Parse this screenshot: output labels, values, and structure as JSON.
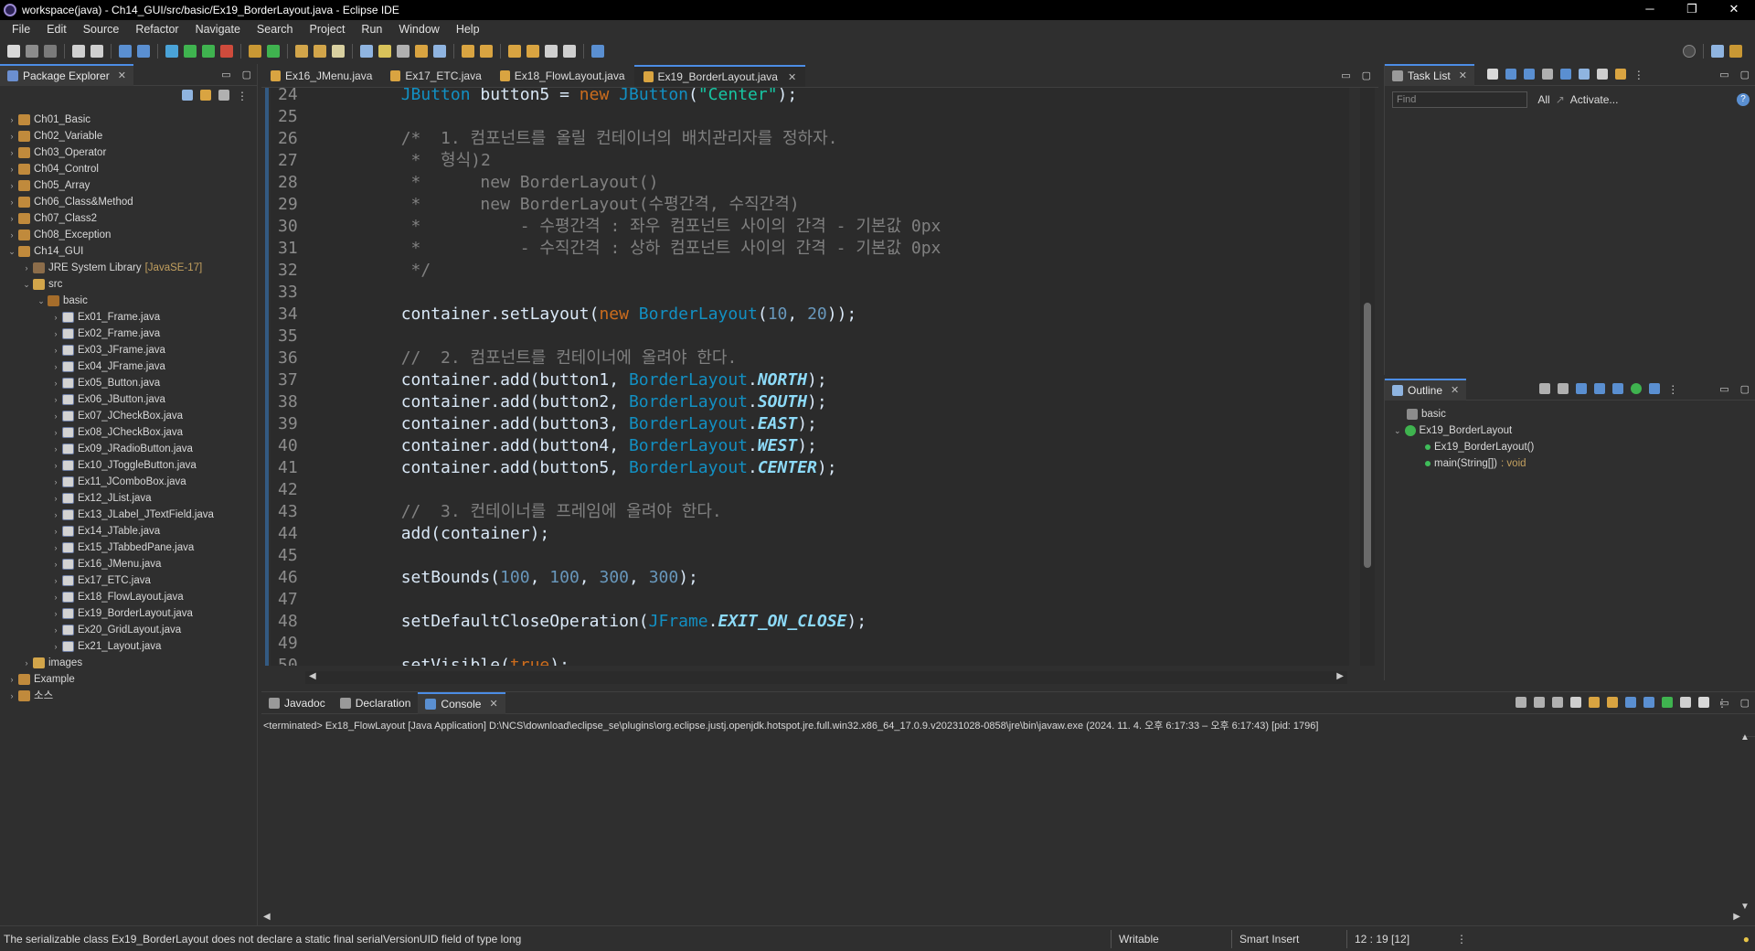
{
  "window": {
    "title": "workspace(java) - Ch14_GUI/src/basic/Ex19_BorderLayout.java - Eclipse IDE",
    "min": "─",
    "max": "❐",
    "close": "✕"
  },
  "menu": [
    "File",
    "Edit",
    "Source",
    "Refactor",
    "Navigate",
    "Search",
    "Project",
    "Run",
    "Window",
    "Help"
  ],
  "package_explorer": {
    "tab": "Package Explorer",
    "items": [
      {
        "label": "Ch01_Basic",
        "indent": 0,
        "arrow": "›",
        "icon": "proj"
      },
      {
        "label": "Ch02_Variable",
        "indent": 0,
        "arrow": "›",
        "icon": "proj"
      },
      {
        "label": "Ch03_Operator",
        "indent": 0,
        "arrow": "›",
        "icon": "proj"
      },
      {
        "label": "Ch04_Control",
        "indent": 0,
        "arrow": "›",
        "icon": "proj"
      },
      {
        "label": "Ch05_Array",
        "indent": 0,
        "arrow": "›",
        "icon": "proj"
      },
      {
        "label": "Ch06_Class&Method",
        "indent": 0,
        "arrow": "›",
        "icon": "proj"
      },
      {
        "label": "Ch07_Class2",
        "indent": 0,
        "arrow": "›",
        "icon": "proj"
      },
      {
        "label": "Ch08_Exception",
        "indent": 0,
        "arrow": "›",
        "icon": "proj"
      },
      {
        "label": "Ch14_GUI",
        "indent": 0,
        "arrow": "⌄",
        "icon": "proj"
      },
      {
        "label": "JRE System Library",
        "decor": "[JavaSE-17]",
        "indent": 1,
        "arrow": "›",
        "icon": "lib"
      },
      {
        "label": "src",
        "indent": 1,
        "arrow": "⌄",
        "icon": "folder"
      },
      {
        "label": "basic",
        "indent": 2,
        "arrow": "⌄",
        "icon": "pkgi"
      },
      {
        "label": "Ex01_Frame.java",
        "indent": 3,
        "arrow": "›",
        "icon": "javaf"
      },
      {
        "label": "Ex02_Frame.java",
        "indent": 3,
        "arrow": "›",
        "icon": "javaf"
      },
      {
        "label": "Ex03_JFrame.java",
        "indent": 3,
        "arrow": "›",
        "icon": "javaf"
      },
      {
        "label": "Ex04_JFrame.java",
        "indent": 3,
        "arrow": "›",
        "icon": "javaf"
      },
      {
        "label": "Ex05_Button.java",
        "indent": 3,
        "arrow": "›",
        "icon": "javaf"
      },
      {
        "label": "Ex06_JButton.java",
        "indent": 3,
        "arrow": "›",
        "icon": "javaf"
      },
      {
        "label": "Ex07_JCheckBox.java",
        "indent": 3,
        "arrow": "›",
        "icon": "javaf"
      },
      {
        "label": "Ex08_JCheckBox.java",
        "indent": 3,
        "arrow": "›",
        "icon": "javaf"
      },
      {
        "label": "Ex09_JRadioButton.java",
        "indent": 3,
        "arrow": "›",
        "icon": "javaf"
      },
      {
        "label": "Ex10_JToggleButton.java",
        "indent": 3,
        "arrow": "›",
        "icon": "javaf"
      },
      {
        "label": "Ex11_JComboBox.java",
        "indent": 3,
        "arrow": "›",
        "icon": "javaf"
      },
      {
        "label": "Ex12_JList.java",
        "indent": 3,
        "arrow": "›",
        "icon": "javaf"
      },
      {
        "label": "Ex13_JLabel_JTextField.java",
        "indent": 3,
        "arrow": "›",
        "icon": "javaf"
      },
      {
        "label": "Ex14_JTable.java",
        "indent": 3,
        "arrow": "›",
        "icon": "javaf"
      },
      {
        "label": "Ex15_JTabbedPane.java",
        "indent": 3,
        "arrow": "›",
        "icon": "javaf"
      },
      {
        "label": "Ex16_JMenu.java",
        "indent": 3,
        "arrow": "›",
        "icon": "javaf"
      },
      {
        "label": "Ex17_ETC.java",
        "indent": 3,
        "arrow": "›",
        "icon": "javaf"
      },
      {
        "label": "Ex18_FlowLayout.java",
        "indent": 3,
        "arrow": "›",
        "icon": "javaf"
      },
      {
        "label": "Ex19_BorderLayout.java",
        "indent": 3,
        "arrow": "›",
        "icon": "javaf"
      },
      {
        "label": "Ex20_GridLayout.java",
        "indent": 3,
        "arrow": "›",
        "icon": "javaf"
      },
      {
        "label": "Ex21_Layout.java",
        "indent": 3,
        "arrow": "›",
        "icon": "javaf"
      },
      {
        "label": "images",
        "indent": 1,
        "arrow": "›",
        "icon": "folder"
      },
      {
        "label": "Example",
        "indent": 0,
        "arrow": "›",
        "icon": "proj"
      },
      {
        "label": "소스",
        "indent": 0,
        "arrow": "›",
        "icon": "proj"
      }
    ]
  },
  "editor": {
    "tabs": [
      "Ex16_JMenu.java",
      "Ex17_ETC.java",
      "Ex18_FlowLayout.java",
      "Ex19_BorderLayout.java"
    ],
    "active_tab": 3,
    "lines": [
      {
        "n": "24",
        "parts": [
          [
            "src",
            "        "
          ],
          [
            "cls",
            "JButton"
          ],
          [
            "src",
            " button5 = "
          ],
          [
            "kw",
            "new"
          ],
          [
            "src",
            " "
          ],
          [
            "cls",
            "JButton"
          ],
          [
            "src",
            "("
          ],
          [
            "str",
            "\"Center\""
          ],
          [
            "src",
            ");"
          ]
        ]
      },
      {
        "n": "25",
        "parts": []
      },
      {
        "n": "26",
        "parts": [
          [
            "cm",
            "        /*  1. 컴포넌트를 올릴 컨테이너의 배치관리자를 정하자."
          ]
        ]
      },
      {
        "n": "27",
        "parts": [
          [
            "cm",
            "         *  형식)2"
          ]
        ]
      },
      {
        "n": "28",
        "parts": [
          [
            "cm",
            "         *      new BorderLayout()"
          ]
        ]
      },
      {
        "n": "29",
        "parts": [
          [
            "cm",
            "         *      new BorderLayout(수평간격, 수직간격)"
          ]
        ]
      },
      {
        "n": "30",
        "parts": [
          [
            "cm",
            "         *          - 수평간격 : 좌우 컴포넌트 사이의 간격 - 기본값 0px"
          ]
        ]
      },
      {
        "n": "31",
        "parts": [
          [
            "cm",
            "         *          - 수직간격 : 상하 컴포넌트 사이의 간격 - 기본값 0px"
          ]
        ]
      },
      {
        "n": "32",
        "parts": [
          [
            "cm",
            "         */"
          ]
        ]
      },
      {
        "n": "33",
        "parts": []
      },
      {
        "n": "34",
        "parts": [
          [
            "src",
            "        container.setLayout("
          ],
          [
            "kw",
            "new"
          ],
          [
            "src",
            " "
          ],
          [
            "cls",
            "BorderLayout"
          ],
          [
            "src",
            "("
          ],
          [
            "num",
            "10"
          ],
          [
            "src",
            ", "
          ],
          [
            "num",
            "20"
          ],
          [
            "src",
            "));"
          ]
        ]
      },
      {
        "n": "35",
        "parts": []
      },
      {
        "n": "36",
        "parts": [
          [
            "cm",
            "        //  2. 컴포넌트를 컨테이너에 올려야 한다."
          ]
        ]
      },
      {
        "n": "37",
        "parts": [
          [
            "src",
            "        container.add(button1, "
          ],
          [
            "cls",
            "BorderLayout"
          ],
          [
            "src",
            "."
          ],
          [
            "sf",
            "NORTH"
          ],
          [
            "src",
            ");"
          ]
        ]
      },
      {
        "n": "38",
        "parts": [
          [
            "src",
            "        container.add(button2, "
          ],
          [
            "cls",
            "BorderLayout"
          ],
          [
            "src",
            "."
          ],
          [
            "sf",
            "SOUTH"
          ],
          [
            "src",
            ");"
          ]
        ]
      },
      {
        "n": "39",
        "parts": [
          [
            "src",
            "        container.add(button3, "
          ],
          [
            "cls",
            "BorderLayout"
          ],
          [
            "src",
            "."
          ],
          [
            "sf",
            "EAST"
          ],
          [
            "src",
            ");"
          ]
        ]
      },
      {
        "n": "40",
        "parts": [
          [
            "src",
            "        container.add(button4, "
          ],
          [
            "cls",
            "BorderLayout"
          ],
          [
            "src",
            "."
          ],
          [
            "sf",
            "WEST"
          ],
          [
            "src",
            ");"
          ]
        ]
      },
      {
        "n": "41",
        "parts": [
          [
            "src",
            "        container.add(button5, "
          ],
          [
            "cls",
            "BorderLayout"
          ],
          [
            "src",
            "."
          ],
          [
            "sf",
            "CENTER"
          ],
          [
            "src",
            ");"
          ]
        ]
      },
      {
        "n": "42",
        "parts": []
      },
      {
        "n": "43",
        "parts": [
          [
            "cm",
            "        //  3. 컨테이너를 프레임에 올려야 한다."
          ]
        ]
      },
      {
        "n": "44",
        "parts": [
          [
            "src",
            "        add(container);"
          ]
        ]
      },
      {
        "n": "45",
        "parts": []
      },
      {
        "n": "46",
        "parts": [
          [
            "src",
            "        setBounds("
          ],
          [
            "num",
            "100"
          ],
          [
            "src",
            ", "
          ],
          [
            "num",
            "100"
          ],
          [
            "src",
            ", "
          ],
          [
            "num",
            "300"
          ],
          [
            "src",
            ", "
          ],
          [
            "num",
            "300"
          ],
          [
            "src",
            ");"
          ]
        ]
      },
      {
        "n": "47",
        "parts": []
      },
      {
        "n": "48",
        "parts": [
          [
            "src",
            "        setDefaultCloseOperation("
          ],
          [
            "cls",
            "JFrame"
          ],
          [
            "src",
            "."
          ],
          [
            "sf",
            "EXIT_ON_CLOSE"
          ],
          [
            "src",
            ");"
          ]
        ]
      },
      {
        "n": "49",
        "parts": []
      },
      {
        "n": "50",
        "parts": [
          [
            "src",
            "        setVisible("
          ],
          [
            "kw",
            "true"
          ],
          [
            "src",
            ");"
          ]
        ]
      }
    ]
  },
  "task_list": {
    "tab": "Task List",
    "find_placeholder": "Find",
    "all": "All",
    "activate": "Activate..."
  },
  "outline": {
    "tab": "Outline",
    "package": "basic",
    "class": "Ex19_BorderLayout",
    "ctor": "Ex19_BorderLayout()",
    "method": "main(String[])",
    "method_ret": ": void"
  },
  "bottom_panel": {
    "tabs": [
      "Javadoc",
      "Declaration",
      "Console"
    ],
    "active_tab": 2,
    "console_header": "<terminated> Ex18_FlowLayout [Java Application] D:\\NCS\\download\\eclipse_se\\plugins\\org.eclipse.justj.openjdk.hotspot.jre.full.win32.x86_64_17.0.9.v20231028-0858\\jre\\bin\\javaw.exe  (2024. 11. 4. 오후 6:17:33 – 오후 6:17:43) [pid: 1796]"
  },
  "status": {
    "message": "The serializable class Ex19_BorderLayout does not declare a static final serialVersionUID field of type long",
    "writable": "Writable",
    "insert": "Smart Insert",
    "position": "12 : 19 [12]"
  },
  "colors": {
    "accent": "#4c8de5",
    "keyword": "#cc6c1d",
    "string": "#17c6a3",
    "comment": "#808080",
    "class": "#1290c3",
    "static_field": "#8ddaf8",
    "number": "#6897bb"
  }
}
